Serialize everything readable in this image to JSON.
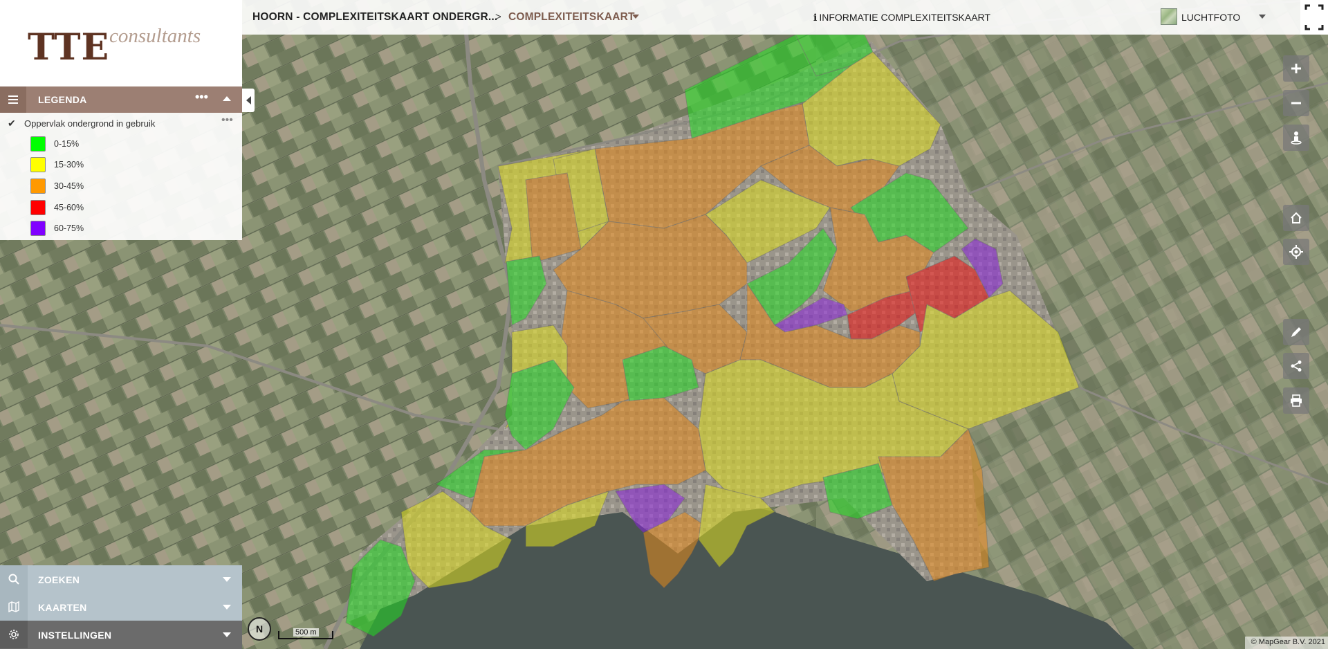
{
  "app": {
    "logo_main": "TTE",
    "logo_sub": "consultants"
  },
  "topbar": {
    "project": "HOORN - COMPLEXITEITSKAART ONDERGR...",
    "separator": ">",
    "current_map": "COMPLEXITEITSKAART",
    "info_icon": "i",
    "info_label": "INFORMATIE COMPLEXITEITSKAART",
    "basemap_label": "LUCHTFOTO",
    "fullscreen_icon": "fullscreen-icon"
  },
  "legend": {
    "title": "LEGENDA",
    "more": "•••",
    "layer": {
      "checked": true,
      "name": "Oppervlak ondergrond in gebruik",
      "more": "•••"
    },
    "classes": [
      {
        "label": "0-15%",
        "color": "#00ff00"
      },
      {
        "label": "15-30%",
        "color": "#ffff00"
      },
      {
        "label": "30-45%",
        "color": "#ff9900"
      },
      {
        "label": "45-60%",
        "color": "#ff0000"
      },
      {
        "label": "60-75%",
        "color": "#8000ff"
      }
    ]
  },
  "panels": {
    "zoeken": "ZOEKEN",
    "kaarten": "KAARTEN",
    "instellingen": "INSTELLINGEN"
  },
  "tools": [
    "zoom-in-icon",
    "zoom-out-icon",
    "street-view-icon",
    "home-icon",
    "locate-icon",
    "measure-icon",
    "share-icon",
    "print-icon"
  ],
  "map": {
    "north_label": "N",
    "scale_label": "500 m",
    "copyright": "© MapGear B.V. 2021",
    "fill_opacity": 0.55,
    "colors": {
      "green": "#22dd22",
      "yellow": "#dede1e",
      "orange": "#e68a1a",
      "red": "#ee1111",
      "purple": "#8a22dd"
    }
  }
}
